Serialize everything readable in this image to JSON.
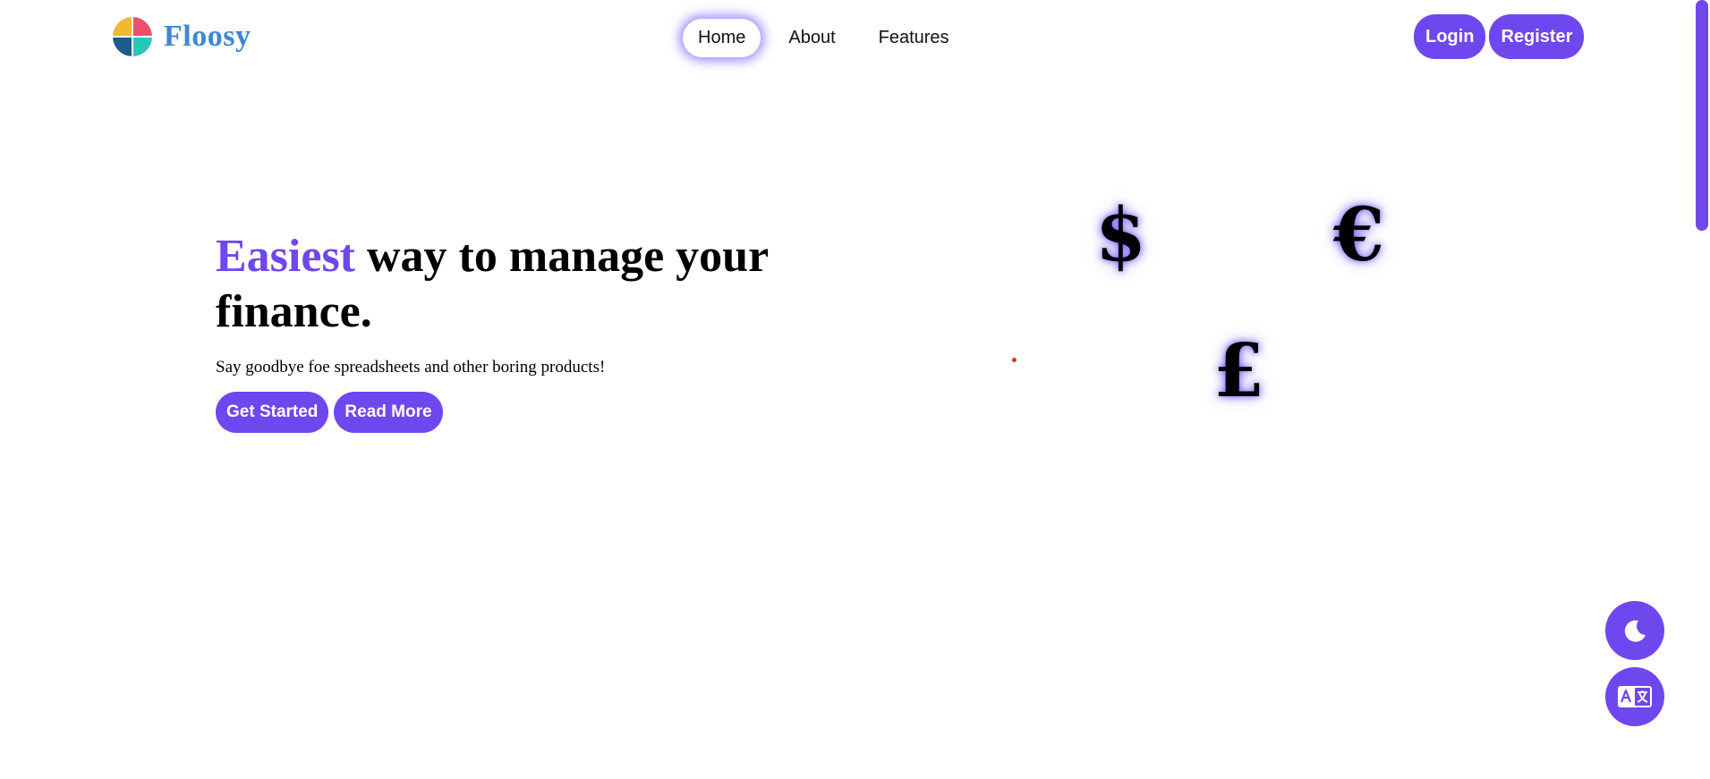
{
  "brand": {
    "name": "Floosy",
    "logo_colors": [
      "#f04e6e",
      "#f4b731",
      "#1a5c8c",
      "#29c7b8"
    ]
  },
  "nav": {
    "items": [
      {
        "label": "Home",
        "active": true
      },
      {
        "label": "About",
        "active": false
      },
      {
        "label": "Features",
        "active": false
      }
    ]
  },
  "auth": {
    "login_label": "Login",
    "register_label": "Register"
  },
  "hero": {
    "title_accent": "Easiest",
    "title_rest": "way to manage your finance.",
    "subtitle": "Say goodbye foe spreadsheets and other boring products!",
    "get_started_label": "Get Started",
    "read_more_label": "Read More"
  },
  "currency_symbols": {
    "dollar": "$",
    "euro": "€",
    "pound": "£"
  },
  "floating_buttons": {
    "theme_icon": "moon-icon",
    "language_icon": "translate-icon"
  },
  "colors": {
    "accent": "#6f47ee",
    "brand_text": "#3d87d6"
  }
}
